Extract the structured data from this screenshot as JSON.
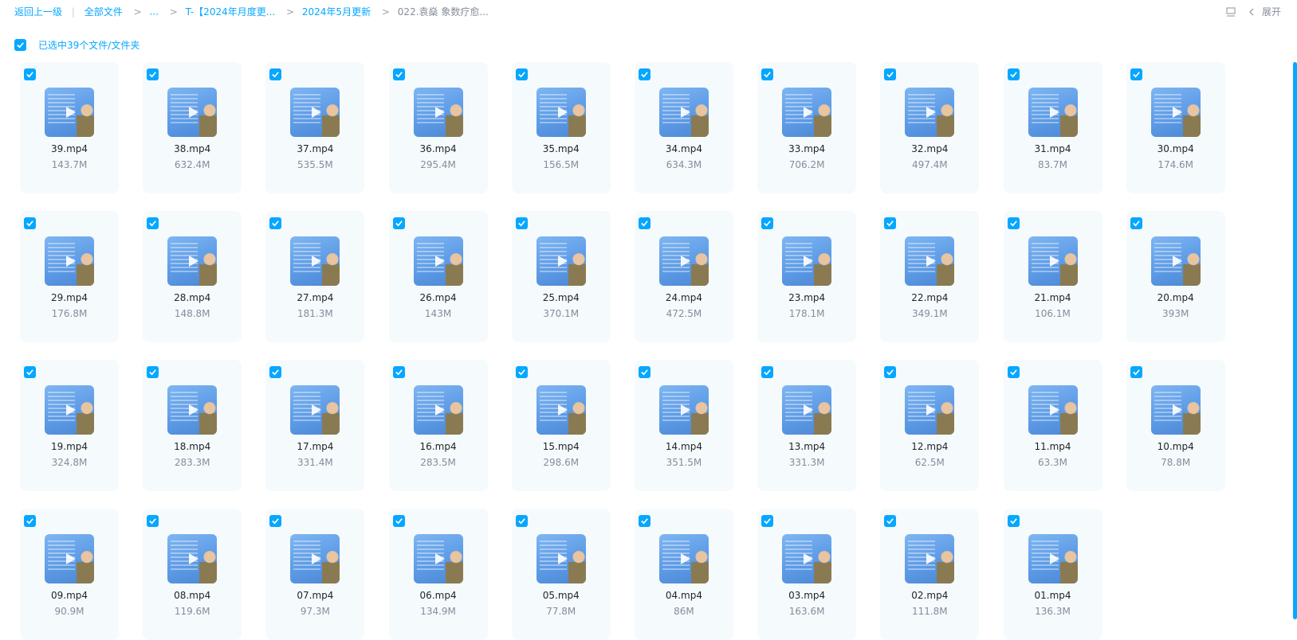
{
  "breadcrumb": {
    "back": "返回上一级",
    "all_files": "全部文件",
    "ellipsis": "...",
    "folder1": "T-【2024年月度更...",
    "folder2": "2024年5月更新",
    "current": "022.袁燊 象数疗愈..."
  },
  "toolbar": {
    "expand_label": "展开"
  },
  "selection": {
    "label": "已选中39个文件/文件夹"
  },
  "files": [
    {
      "name": "39.mp4",
      "size": "143.7M"
    },
    {
      "name": "38.mp4",
      "size": "632.4M"
    },
    {
      "name": "37.mp4",
      "size": "535.5M"
    },
    {
      "name": "36.mp4",
      "size": "295.4M"
    },
    {
      "name": "35.mp4",
      "size": "156.5M"
    },
    {
      "name": "34.mp4",
      "size": "634.3M"
    },
    {
      "name": "33.mp4",
      "size": "706.2M"
    },
    {
      "name": "32.mp4",
      "size": "497.4M"
    },
    {
      "name": "31.mp4",
      "size": "83.7M"
    },
    {
      "name": "30.mp4",
      "size": "174.6M"
    },
    {
      "name": "29.mp4",
      "size": "176.8M"
    },
    {
      "name": "28.mp4",
      "size": "148.8M"
    },
    {
      "name": "27.mp4",
      "size": "181.3M"
    },
    {
      "name": "26.mp4",
      "size": "143M"
    },
    {
      "name": "25.mp4",
      "size": "370.1M"
    },
    {
      "name": "24.mp4",
      "size": "472.5M"
    },
    {
      "name": "23.mp4",
      "size": "178.1M"
    },
    {
      "name": "22.mp4",
      "size": "349.1M"
    },
    {
      "name": "21.mp4",
      "size": "106.1M"
    },
    {
      "name": "20.mp4",
      "size": "393M"
    },
    {
      "name": "19.mp4",
      "size": "324.8M"
    },
    {
      "name": "18.mp4",
      "size": "283.3M"
    },
    {
      "name": "17.mp4",
      "size": "331.4M"
    },
    {
      "name": "16.mp4",
      "size": "283.5M"
    },
    {
      "name": "15.mp4",
      "size": "298.6M"
    },
    {
      "name": "14.mp4",
      "size": "351.5M"
    },
    {
      "name": "13.mp4",
      "size": "331.3M"
    },
    {
      "name": "12.mp4",
      "size": "62.5M"
    },
    {
      "name": "11.mp4",
      "size": "63.3M"
    },
    {
      "name": "10.mp4",
      "size": "78.8M"
    },
    {
      "name": "09.mp4",
      "size": "90.9M"
    },
    {
      "name": "08.mp4",
      "size": "119.6M"
    },
    {
      "name": "07.mp4",
      "size": "97.3M"
    },
    {
      "name": "06.mp4",
      "size": "134.9M"
    },
    {
      "name": "05.mp4",
      "size": "77.8M"
    },
    {
      "name": "04.mp4",
      "size": "86M"
    },
    {
      "name": "03.mp4",
      "size": "163.6M"
    },
    {
      "name": "02.mp4",
      "size": "111.8M"
    },
    {
      "name": "01.mp4",
      "size": "136.3M"
    }
  ],
  "colors": {
    "accent": "#06a7ff",
    "card_bg": "#f5fafd",
    "text": "#1f2329",
    "muted": "#878c9c"
  },
  "icons": {
    "checkbox": "checkbox-checked-icon",
    "play": "play-icon",
    "view": "list-view-icon",
    "chevron": "chevron-left-icon"
  }
}
